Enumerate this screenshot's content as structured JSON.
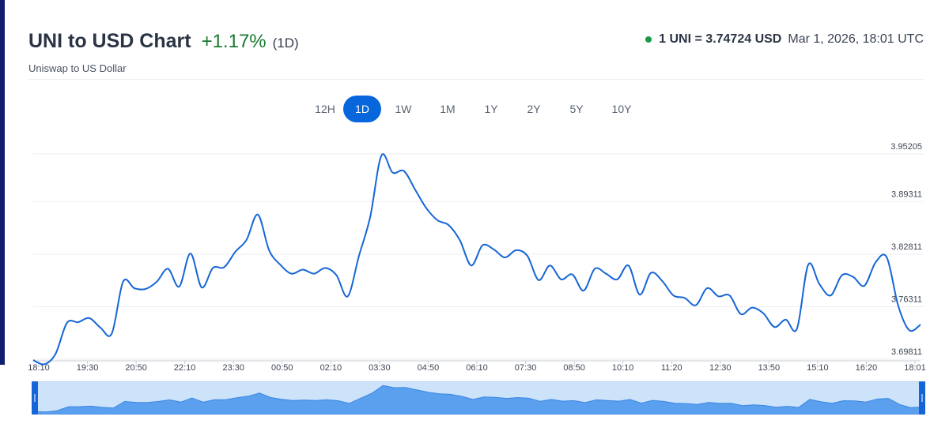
{
  "header": {
    "title": "UNI to USD Chart",
    "change": "+1.17%",
    "period": "(1D)",
    "subtitle": "Uniswap to US Dollar",
    "rate": "1 UNI = 3.74724 USD",
    "timestamp": "Mar 1, 2026, 18:01 UTC"
  },
  "tabs": [
    {
      "label": "12H",
      "active": false
    },
    {
      "label": "1D",
      "active": true
    },
    {
      "label": "1W",
      "active": false
    },
    {
      "label": "1M",
      "active": false
    },
    {
      "label": "1Y",
      "active": false
    },
    {
      "label": "2Y",
      "active": false
    },
    {
      "label": "5Y",
      "active": false
    },
    {
      "label": "10Y",
      "active": false
    }
  ],
  "colors": {
    "line": "#1666d6",
    "navigator_fill": "#5ba0ee",
    "navigator_mask": "#cce3fa",
    "positive": "#1a7a32",
    "active_tab": "#0866dd"
  },
  "chart_data": {
    "type": "line",
    "x_tick_labels": [
      "18:10",
      "19:30",
      "20:50",
      "22:10",
      "23:30",
      "00:50",
      "02:10",
      "03:30",
      "04:50",
      "06:10",
      "07:30",
      "08:50",
      "10:10",
      "11:20",
      "12:30",
      "13:50",
      "15:10",
      "16:20",
      "18:01"
    ],
    "y_ticks": [
      3.69811,
      3.76311,
      3.82811,
      3.89311,
      3.95205
    ],
    "y_tick_labels": [
      "3.69811",
      "3.76311",
      "3.82811",
      "3.89311",
      "3.95205"
    ],
    "ylim": [
      3.69811,
      3.95205
    ],
    "grid": true,
    "series": [
      {
        "values": [
          3.697,
          3.692,
          3.705,
          3.743,
          3.744,
          3.749,
          3.737,
          3.73,
          3.794,
          3.786,
          3.785,
          3.794,
          3.81,
          3.788,
          3.829,
          3.787,
          3.811,
          3.812,
          3.831,
          3.846,
          3.877,
          3.833,
          3.815,
          3.804,
          3.809,
          3.804,
          3.811,
          3.802,
          3.776,
          3.826,
          3.874,
          3.95,
          3.929,
          3.931,
          3.908,
          3.885,
          3.87,
          3.864,
          3.845,
          3.814,
          3.839,
          3.834,
          3.824,
          3.833,
          3.826,
          3.796,
          3.814,
          3.797,
          3.803,
          3.783,
          3.81,
          3.804,
          3.797,
          3.814,
          3.778,
          3.805,
          3.795,
          3.777,
          3.774,
          3.765,
          3.786,
          3.776,
          3.777,
          3.754,
          3.762,
          3.755,
          3.738,
          3.747,
          3.736,
          3.815,
          3.791,
          3.777,
          3.802,
          3.8,
          3.789,
          3.818,
          3.824,
          3.765,
          3.734,
          3.741
        ]
      }
    ]
  }
}
